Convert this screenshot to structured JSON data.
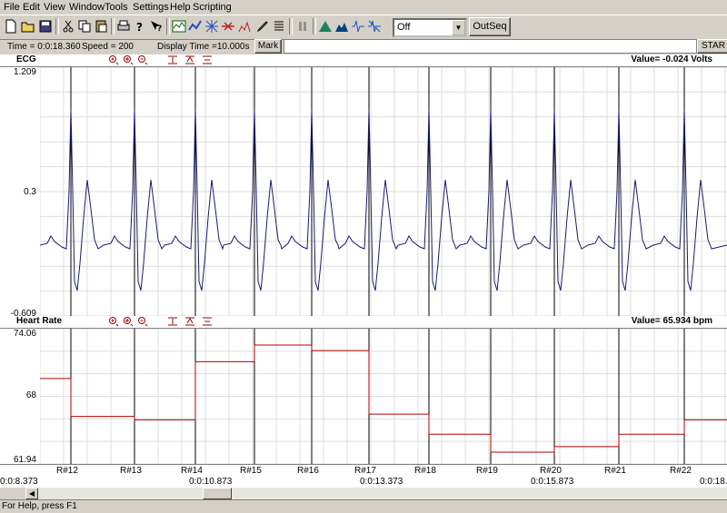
{
  "menu": [
    "File",
    "Edit",
    "View",
    "Window",
    "Tools",
    "Settings",
    "Help",
    "Scripting"
  ],
  "toolbar": {
    "dropdown_value": "Off",
    "outseq_label": "OutSeq",
    "mark_label": "Mark",
    "start_label": "STAR"
  },
  "info": {
    "time": "Time = 0:0:18.360",
    "speed": "Speed  = 200",
    "display_time": "Display Time =10.000s"
  },
  "ecg": {
    "title": "ECG",
    "value": "Value= -0.024 Volts",
    "ymax": "1.209",
    "ymid": "0.3",
    "ymin": "-0.609",
    "trace_color": "#1a1a6e"
  },
  "hr": {
    "title": "Heart Rate",
    "value": "Value= 65.934 bpm",
    "ymax": "74.06",
    "ymid": "68",
    "ymin": "61.94",
    "trace_color": "#b00000"
  },
  "chart_data": [
    {
      "type": "line",
      "title": "ECG",
      "ylabel": "Volts",
      "ylim": [
        -0.609,
        1.209
      ],
      "note_value": -0.024
    },
    {
      "type": "line",
      "title": "Heart Rate",
      "ylabel": "bpm",
      "ylim": [
        61.94,
        74.06
      ],
      "beats": [
        "R#12",
        "R#13",
        "R#14",
        "R#15",
        "R#16",
        "R#17",
        "R#18",
        "R#19",
        "R#20",
        "R#21",
        "R#22"
      ],
      "bpm": [
        69.6,
        66.2,
        65.9,
        71.1,
        72.6,
        72.1,
        66.4,
        64.6,
        63.0,
        63.5,
        64.6,
        65.9
      ]
    }
  ],
  "rpeaks": [
    "R#12",
    "R#13",
    "R#14",
    "R#15",
    "R#16",
    "R#17",
    "R#18",
    "R#19",
    "R#20",
    "R#21",
    "R#22"
  ],
  "times": [
    "0:0:8.373",
    "0:0:10.873",
    "0:0:13.373",
    "0:0:15.873",
    "0:0:18."
  ],
  "status": "For Help, press F1"
}
